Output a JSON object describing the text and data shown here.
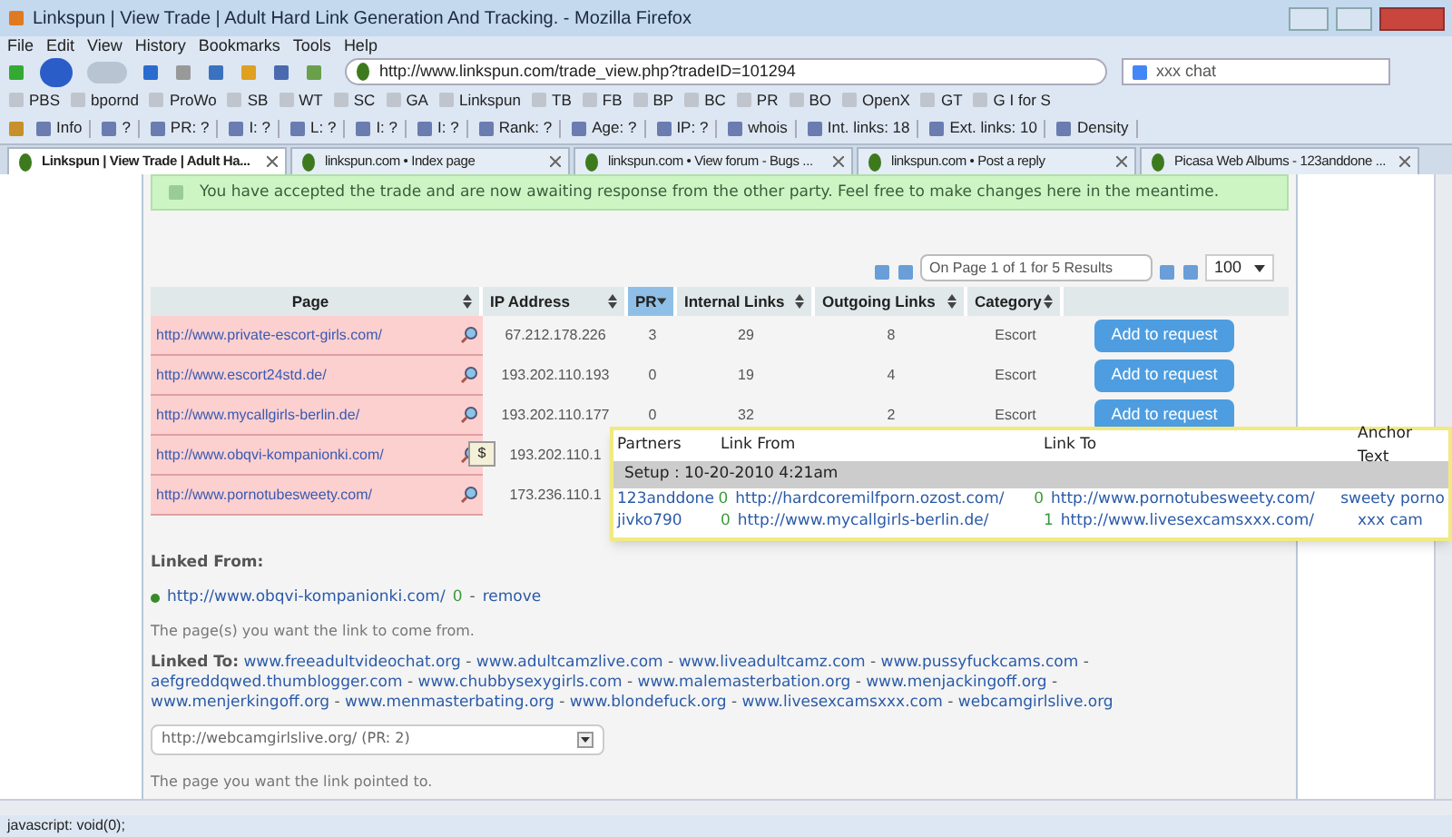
{
  "window": {
    "title": "Linkspun | View Trade | Adult Hard Link Generation And Tracking. - Mozilla Firefox"
  },
  "menu": [
    "File",
    "Edit",
    "View",
    "History",
    "Bookmarks",
    "Tools",
    "Help"
  ],
  "address_bar": {
    "value": "http://www.linkspun.com/trade_view.php?tradeID=101294"
  },
  "search_field": {
    "value": "xxx chat"
  },
  "bookmarks": [
    "PBS",
    "bpornd",
    "ProWo",
    "SB",
    "WT",
    "SC",
    "GA",
    "Linkspun",
    "TB",
    "FB",
    "BP",
    "BC",
    "PR",
    "BO",
    "OpenX",
    "GT",
    "G I for S"
  ],
  "seo_toolbar": [
    "Info",
    "?",
    "PR: ?",
    "I: ?",
    "L: ?",
    "I: ?",
    "I: ?",
    "Rank: ?",
    "Age: ?",
    "IP: ?",
    "whois",
    "Int. links: 18",
    "Ext. links: 10",
    "Density"
  ],
  "tabs": [
    {
      "label": "Linkspun | View Trade | Adult Ha...",
      "selected": true
    },
    {
      "label": "linkspun.com • Index page",
      "selected": false
    },
    {
      "label": "linkspun.com • View forum - Bugs ...",
      "selected": false
    },
    {
      "label": "linkspun.com • Post a reply",
      "selected": false
    },
    {
      "label": "Picasa Web Albums - 123anddone ...",
      "selected": false
    }
  ],
  "notice": "You have accepted the trade and are now awaiting response from the other party. Feel free to make changes here in the meantime.",
  "pager": {
    "status": "On Page 1 of 1 for 5 Results",
    "page_size": "100"
  },
  "table": {
    "columns": [
      {
        "label": "Page",
        "sorted": false
      },
      {
        "label": "IP Address",
        "sorted": false
      },
      {
        "label": "PR",
        "sorted": true
      },
      {
        "label": "Internal Links",
        "sorted": false
      },
      {
        "label": "Outgoing Links",
        "sorted": false
      },
      {
        "label": "Category",
        "sorted": false
      }
    ],
    "rows": [
      {
        "page": "http://www.private-escort-girls.com/",
        "ip": "67.212.178.226",
        "pr": "3",
        "internal": "29",
        "outgoing": "8",
        "category": "Escort",
        "button": "Add to request"
      },
      {
        "page": "http://www.escort24std.de/",
        "ip": "193.202.110.193",
        "pr": "0",
        "internal": "19",
        "outgoing": "4",
        "category": "Escort",
        "button": "Add to request"
      },
      {
        "page": "http://www.mycallgirls-berlin.de/",
        "ip": "193.202.110.177",
        "pr": "0",
        "internal": "32",
        "outgoing": "2",
        "category": "Escort",
        "button": "Add to request"
      },
      {
        "page": "http://www.obqvi-kompanionki.com/",
        "ip": "193.202.110.1"
      },
      {
        "page": "http://www.pornotubesweety.com/",
        "ip": "173.236.110.1"
      }
    ]
  },
  "popup": {
    "columns": [
      "Partners",
      "Link From",
      "Link To",
      "Anchor Text"
    ],
    "setup": "Setup : 10-20-2010 4:21am",
    "rows": [
      {
        "partner": "123anddone",
        "from_count": "0",
        "from": "http://hardcoremilfporn.ozost.com/",
        "to_count": "0",
        "to": "http://www.pornotubesweety.com/",
        "anchor": "sweety porno"
      },
      {
        "partner": "jivko790",
        "from_count": "0",
        "from": "http://www.mycallgirls-berlin.de/",
        "to_count": "1",
        "to": "http://www.livesexcamsxxx.com/",
        "anchor": "xxx cam"
      }
    ]
  },
  "linked_from": {
    "heading": "Linked From:",
    "link": "http://www.obqvi-kompanionki.com/",
    "count": "0",
    "remove": "remove",
    "hint": "The page(s) you want the link to come from."
  },
  "linked_to": {
    "heading": "Linked To:",
    "links": [
      "www.freeadultvideochat.org",
      "www.adultcamzlive.com",
      "www.liveadultcamz.com",
      "www.pussyfuckcams.com",
      "aefgreddqwed.thumblogger.com",
      "www.chubbysexygirls.com",
      "www.malemasterbation.org",
      "www.menjackingoff.org",
      "www.menjerkingoff.org",
      "www.menmasterbating.org",
      "www.blondefuck.org",
      "www.livesexcamsxxx.com",
      "webcamgirlslive.org"
    ],
    "select": "http://webcamgirlslive.org/ (PR: 2)",
    "hint": "The page you want the link pointed to."
  },
  "separator": "-",
  "tooltip_icon": "$",
  "status_bar": "javascript: void(0);"
}
